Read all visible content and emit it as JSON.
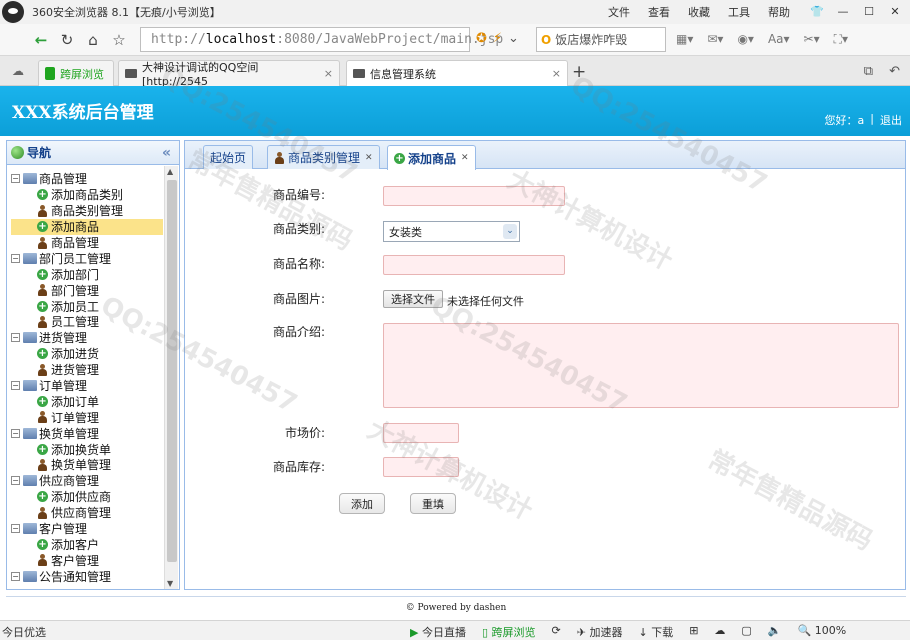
{
  "browser": {
    "title": "360安全浏览器 8.1【无痕/小号浏览】",
    "menus": [
      "文件",
      "查看",
      "收藏",
      "工具",
      "帮助"
    ],
    "url_prefix": "http://",
    "url_host": "localhost",
    "url_rest": ":8080/JavaWebProject/main.jsp",
    "search_text": "饭店爆炸咋毁",
    "tabs": [
      {
        "label": "跨屏浏览"
      },
      {
        "label": "大神设计调试的QQ空间 [http://2545"
      },
      {
        "label": "信息管理系统"
      }
    ]
  },
  "app": {
    "title": "XXX系统后台管理",
    "greeting": "您好：a",
    "logout": "退出"
  },
  "nav": {
    "title": "导航",
    "groups": [
      {
        "label": "商品管理",
        "items": [
          "添加商品类别",
          "商品类别管理",
          "添加商品",
          "商品管理"
        ]
      },
      {
        "label": "部门员工管理",
        "items": [
          "添加部门",
          "部门管理",
          "添加员工",
          "员工管理"
        ]
      },
      {
        "label": "进货管理",
        "items": [
          "添加进货",
          "进货管理"
        ]
      },
      {
        "label": "订单管理",
        "items": [
          "添加订单",
          "订单管理"
        ]
      },
      {
        "label": "换货单管理",
        "items": [
          "添加换货单",
          "换货单管理"
        ]
      },
      {
        "label": "供应商管理",
        "items": [
          "添加供应商",
          "供应商管理"
        ]
      },
      {
        "label": "客户管理",
        "items": [
          "添加客户",
          "客户管理"
        ]
      },
      {
        "label": "公告通知管理",
        "items": []
      }
    ]
  },
  "content_tabs": [
    {
      "label": "起始页"
    },
    {
      "label": "商品类别管理"
    },
    {
      "label": "添加商品"
    }
  ],
  "form": {
    "labels": {
      "code": "商品编号:",
      "category": "商品类别:",
      "name": "商品名称:",
      "image": "商品图片:",
      "intro": "商品介绍:",
      "price": "市场价:",
      "stock": "商品库存:"
    },
    "category_value": "女装类",
    "file_button": "选择文件",
    "file_status": "未选择任何文件",
    "submit": "添加",
    "reset": "重填"
  },
  "footer": "© Powered by dashen",
  "statusbar": {
    "left": "今日优选",
    "items": [
      "今日直播",
      "跨屏浏览",
      "加速器",
      "下载",
      "100%"
    ]
  },
  "watermark": [
    "QQ:254540457",
    "大神计算机设计",
    "常年售精品源码"
  ]
}
